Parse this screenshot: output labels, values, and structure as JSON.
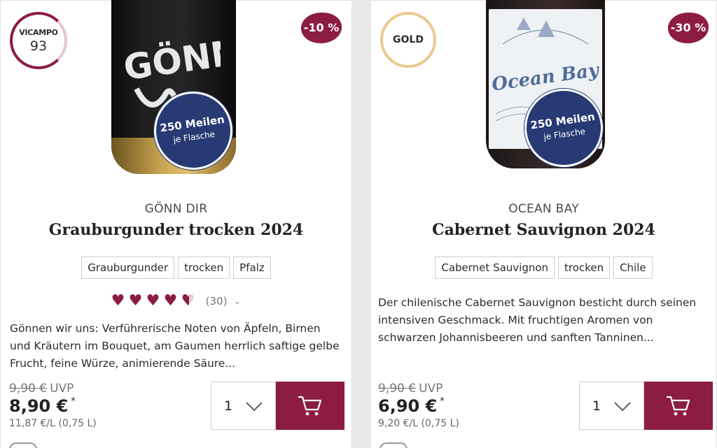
{
  "products": [
    {
      "score_badge": {
        "brand": "VICAMPO",
        "score": "93"
      },
      "discount": "-10 %",
      "bottle_label_text": "GÖNN DIR",
      "miles": {
        "line1": "250 Meilen",
        "line2": "je Flasche"
      },
      "producer": "GÖNN DIR",
      "title": "Grauburgunder trocken 2024",
      "tags": [
        "Grauburgunder",
        "trocken",
        "Pfalz"
      ],
      "rating": {
        "hearts": 4.5,
        "count": "(30)"
      },
      "description": "Gönnen wir uns: Verführerische Noten von Äpfeln, Birnen und Kräutern im Bouquet, am Gaumen herrlich saftige gelbe Frucht, feine Würze, animierende Säure...",
      "uvp_old": "9,90 €",
      "uvp_label": "UVP",
      "price": "8,90 €",
      "price_mark": "*",
      "per_liter": "11,87 €/L (0,75 L)",
      "quantity": "1"
    },
    {
      "award_badge": "GOLD",
      "discount": "-30 %",
      "bottle_label_text": "Ocean Bay",
      "miles": {
        "line1": "250 Meilen",
        "line2": "je Flasche"
      },
      "producer": "OCEAN BAY",
      "title": "Cabernet Sauvignon 2024",
      "tags": [
        "Cabernet Sauvignon",
        "trocken",
        "Chile"
      ],
      "description": "Der chilenische Cabernet Sauvignon besticht durch seinen intensiven Geschmack. Mit fruchtigen Aromen von schwarzen Johannisbeeren und sanften Tanninen...",
      "uvp_old": "9,90 €",
      "uvp_label": "UVP",
      "price": "6,90 €",
      "price_mark": "*",
      "per_liter": "9,20 €/L (0,75 L)",
      "quantity": "1"
    }
  ],
  "colors": {
    "accent": "#8c1d40",
    "miles_badge": "#273a73",
    "gold_ring": "#e9c98e"
  },
  "icons": {
    "cart": "cart-icon",
    "dropdown": "chevron-down-icon",
    "rating": "heart-icon"
  }
}
